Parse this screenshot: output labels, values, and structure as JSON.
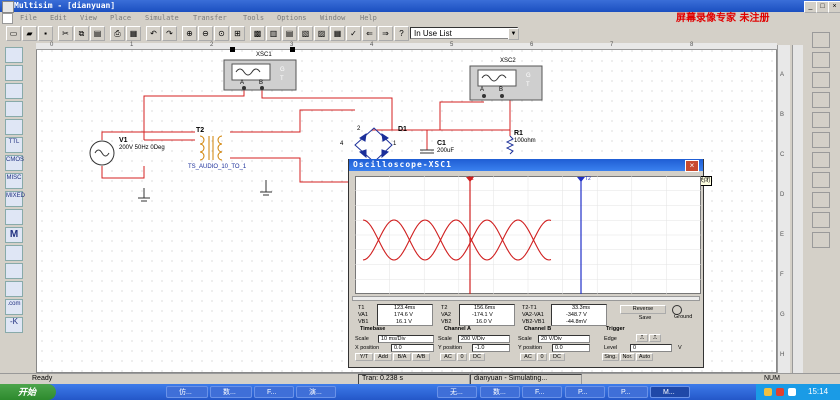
{
  "window": {
    "title": "Multisim - [dianyuan]",
    "watermark": "屏幕录像专家 未注册"
  },
  "menu": [
    "File",
    "Edit",
    "View",
    "Place",
    "Simulate",
    "Transfer",
    "Tools",
    "Options",
    "Window",
    "Help"
  ],
  "toolbar": {
    "in_use_list": "In Use List"
  },
  "left_toolbar": [
    "",
    "",
    "",
    "",
    "",
    "TTL",
    "CMOS",
    "MISC",
    "MIXED",
    "",
    "M",
    "",
    "",
    "",
    ".com"
  ],
  "rulers": {
    "top": [
      "0",
      "1",
      "2",
      "3",
      "4",
      "5",
      "6",
      "7",
      "8"
    ],
    "right": [
      "A",
      "B",
      "C",
      "D",
      "E",
      "F",
      "G",
      "H"
    ]
  },
  "schematic": {
    "xsc1": {
      "name": "XSC1",
      "g": "G",
      "t": "T",
      "a": "A",
      "b": "B"
    },
    "xsc2": {
      "name": "XSC2",
      "g": "G",
      "t": "T",
      "a": "A",
      "b": "B"
    },
    "v1": {
      "name": "V1",
      "spec": "200V 50Hz 0Deg"
    },
    "t2": {
      "name": "T2",
      "model": "TS_AUDIO_10_TO_1"
    },
    "d1": {
      "name": "D1",
      "pins": [
        "1",
        "2",
        "3",
        "4"
      ]
    },
    "c1": {
      "name": "C1",
      "value": "200uF"
    },
    "r1": {
      "name": "R1",
      "value": "100ohm"
    }
  },
  "oscilloscope": {
    "title": "Oscilloscope-XSC1",
    "close_tooltip": "关闭",
    "cursor_labels": [
      "T1",
      "T2"
    ],
    "readouts": {
      "t1": {
        "label": "T1",
        "time": "123.4ms",
        "va1": "174.6 V",
        "vb1": "16.1 V",
        "va1_label": "VA1",
        "vb1_label": "VB1"
      },
      "t2": {
        "label": "T2",
        "time": "156.6ms",
        "va2": "-174.1 V",
        "vb2": "16.0 V",
        "va2_label": "VA2",
        "vb2_label": "VB2"
      },
      "diff": {
        "label": "T2-T1",
        "time": "33.3ms",
        "dva": "-348.7 V",
        "dvb": "-44.8mV",
        "dva_label": "VA2-VA1",
        "dvb_label": "VB2-VB1"
      }
    },
    "reverse_label": "Reverse",
    "save_label": "Save",
    "ground_label": "Ground",
    "timebase": {
      "title": "Timebase",
      "scale_label": "Scale",
      "scale_value": "10 ms/Div",
      "xpos_label": "X position",
      "xpos_value": "0.0",
      "buttons": [
        "Y/T",
        "Add",
        "B/A",
        "A/B"
      ]
    },
    "channel_a": {
      "title": "Channel A",
      "scale_label": "Scale",
      "scale_value": "200 V/Div",
      "ypos_label": "Y position",
      "ypos_value": "-1.0",
      "buttons": [
        "AC",
        "0",
        "DC"
      ]
    },
    "channel_b": {
      "title": "Channel B",
      "scale_label": "Scale",
      "scale_value": "20 V/Div",
      "ypos_label": "Y position",
      "ypos_value": "0.0",
      "buttons": [
        "AC",
        "0",
        "DC"
      ]
    },
    "trigger": {
      "title": "Trigger",
      "edge_label": "Edge",
      "level_label": "Level",
      "level_value": "0",
      "level_unit": "V",
      "buttons": [
        "Sing.",
        "Nor.",
        "Auto"
      ]
    },
    "trace_color": "#d02020"
  },
  "status": {
    "ready": "Ready",
    "tran": "Tran: 0.238 s",
    "sim": "dianyuan - Simulating...",
    "num": "NUM"
  },
  "taskbar": {
    "start": "开始",
    "tasks": [
      "仿...",
      "数...",
      "F...",
      "演...",
      "无...",
      "数...",
      "F...",
      "P...",
      "P...",
      "M..."
    ],
    "clock": "15:14"
  }
}
